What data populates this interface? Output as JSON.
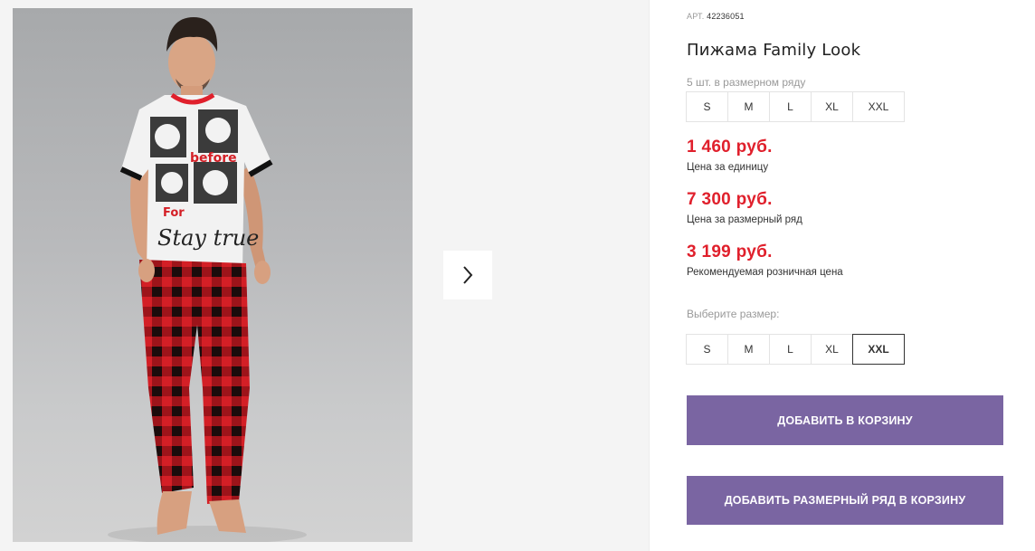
{
  "gallery": {
    "photo_alt": "",
    "tshirt_print": [
      "before",
      "For",
      "Stay true"
    ],
    "next_icon": "chevron-right-icon"
  },
  "product": {
    "article_prefix": "АРТ.",
    "article_value": "42236051",
    "title": "Пижама Family Look",
    "range_label": "5 шт. в размерном ряду",
    "range_sizes": [
      "S",
      "M",
      "L",
      "XL",
      "XXL"
    ]
  },
  "prices": {
    "unit_price": "1 460 руб.",
    "unit_label": "Цена за единицу",
    "range_price": "7 300 руб.",
    "range_label": "Цена за размерный ряд",
    "retail_price": "3 199 руб.",
    "retail_label": "Рекомендуемая розничная цена",
    "price_color": "#e0202c"
  },
  "size_picker": {
    "label": "Выберите размер:",
    "sizes": [
      "S",
      "M",
      "L",
      "XL",
      "XXL"
    ],
    "selected": "XXL"
  },
  "actions": {
    "add_to_cart": "ДОБАВИТЬ В КОРЗИНУ",
    "add_range_to_cart": "ДОБАВИТЬ РАЗМЕРНЫЙ РЯД В КОРЗИНУ",
    "button_color": "#7a65a2"
  }
}
